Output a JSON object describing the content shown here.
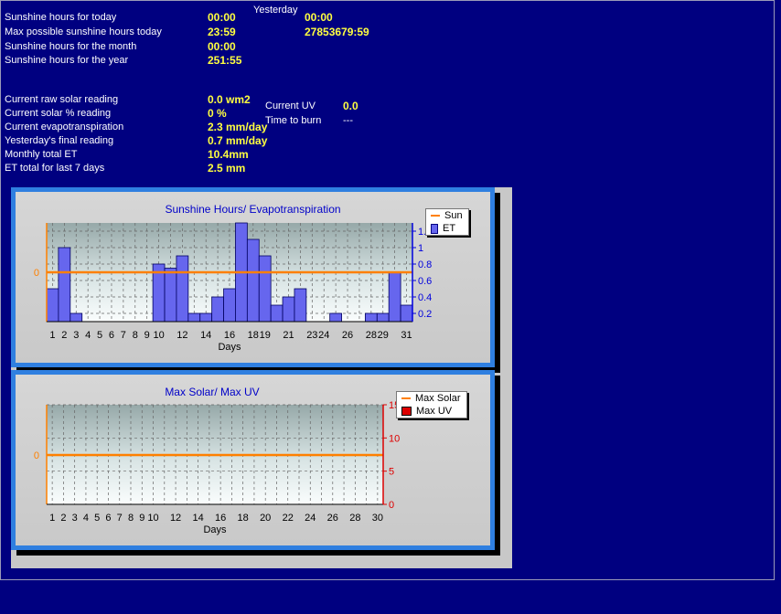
{
  "stats": {
    "yesterday_header": "Yesterday",
    "rows": [
      {
        "label": "Sunshine hours for today",
        "value": "00:00",
        "yesterday": "00:00"
      },
      {
        "label": "Max possible sunshine hours today",
        "value": "23:59",
        "yesterday": "27853679:59"
      },
      {
        "label": "Sunshine hours for the month",
        "value": "00:00"
      },
      {
        "label": "Sunshine hours for the year",
        "value": "251:55"
      }
    ],
    "solar_rows": [
      {
        "label": "Current raw solar reading",
        "value": "0.0 wm2"
      },
      {
        "label": "Current solar % reading",
        "value": "0 %"
      },
      {
        "label": "Current evapotranspiration",
        "value": "2.3 mm/day"
      },
      {
        "label": "Yesterday's final reading",
        "value": "0.7 mm/day"
      },
      {
        "label": "Monthly total ET",
        "value": "10.4mm"
      },
      {
        "label": "ET total for last 7 days",
        "value": "2.5 mm"
      }
    ],
    "uv": {
      "label": "Current UV",
      "value": "0.0"
    },
    "burn": {
      "label": "Time to burn",
      "value": "---"
    }
  },
  "colors": {
    "background": "#000080",
    "accent": "#2f7fe0",
    "sun_line": "#ff8000",
    "et_bar": "#6666ee",
    "uv_axis": "#dd0000"
  },
  "chart_data": [
    {
      "type": "bar",
      "title": "Sunshine Hours/ Evapotranspiration",
      "xlabel": "Days",
      "x_ticks": [
        "1",
        "2",
        "3",
        "4",
        "5",
        "6",
        "7",
        "8",
        "9",
        "10",
        "12",
        "14",
        "16",
        "18",
        "19",
        "21",
        "23",
        "24",
        "26",
        "28",
        "29",
        "31"
      ],
      "x": [
        1,
        2,
        3,
        4,
        5,
        6,
        7,
        8,
        9,
        10,
        11,
        12,
        13,
        14,
        15,
        16,
        17,
        18,
        19,
        20,
        21,
        22,
        23,
        24,
        25,
        26,
        27,
        28,
        29,
        30,
        31
      ],
      "left_axis": {
        "ticks": [
          "0"
        ]
      },
      "right_axis": {
        "ticks": [
          "0.2",
          "0.4",
          "0.6",
          "0.8",
          "1",
          "1.2"
        ],
        "ylim": [
          0.1,
          1.3
        ]
      },
      "series": [
        {
          "name": "Sun",
          "kind": "line",
          "values": [
            0,
            0,
            0,
            0,
            0,
            0,
            0,
            0,
            0,
            0,
            0,
            0,
            0,
            0,
            0,
            0,
            0,
            0,
            0,
            0,
            0,
            0,
            0,
            0,
            0,
            0,
            0,
            0,
            0,
            0,
            0
          ]
        },
        {
          "name": "ET",
          "kind": "bar",
          "values": [
            0.5,
            1.0,
            0.2,
            0.1,
            0.1,
            0.1,
            0.1,
            0.1,
            0.1,
            0.8,
            0.75,
            0.9,
            0.2,
            0.2,
            0.4,
            0.5,
            1.4,
            1.1,
            0.9,
            0.3,
            0.4,
            0.5,
            0.1,
            0.1,
            0.2,
            0.1,
            0.1,
            0.2,
            0.2,
            0.7,
            0.3
          ]
        }
      ],
      "grid": true,
      "legend": "top-right"
    },
    {
      "type": "line",
      "title": "Max Solar/ Max UV",
      "xlabel": "Days",
      "x_ticks": [
        "1",
        "2",
        "3",
        "4",
        "5",
        "6",
        "7",
        "8",
        "9",
        "10",
        "12",
        "14",
        "16",
        "18",
        "20",
        "22",
        "24",
        "26",
        "28",
        "30"
      ],
      "x": [
        1,
        2,
        3,
        4,
        5,
        6,
        7,
        8,
        9,
        10,
        11,
        12,
        13,
        14,
        15,
        16,
        17,
        18,
        19,
        20,
        21,
        22,
        23,
        24,
        25,
        26,
        27,
        28,
        29,
        30
      ],
      "left_axis": {
        "ticks": [
          "0"
        ]
      },
      "right_axis": {
        "ticks": [
          "0",
          "5",
          "10",
          "15"
        ],
        "ylim": [
          0,
          15
        ]
      },
      "series": [
        {
          "name": "Max Solar",
          "kind": "line",
          "values": [
            0,
            0,
            0,
            0,
            0,
            0,
            0,
            0,
            0,
            0,
            0,
            0,
            0,
            0,
            0,
            0,
            0,
            0,
            0,
            0,
            0,
            0,
            0,
            0,
            0,
            0,
            0,
            0,
            0,
            0
          ]
        },
        {
          "name": "Max UV",
          "kind": "bar",
          "values": [
            0,
            0,
            0,
            0,
            0,
            0,
            0,
            0,
            0,
            0,
            0,
            0,
            0,
            0,
            0,
            0,
            0,
            0,
            0,
            0,
            0,
            0,
            0,
            0,
            0,
            0,
            0,
            0,
            0,
            0
          ]
        }
      ],
      "grid": true,
      "legend": "top-right"
    }
  ]
}
